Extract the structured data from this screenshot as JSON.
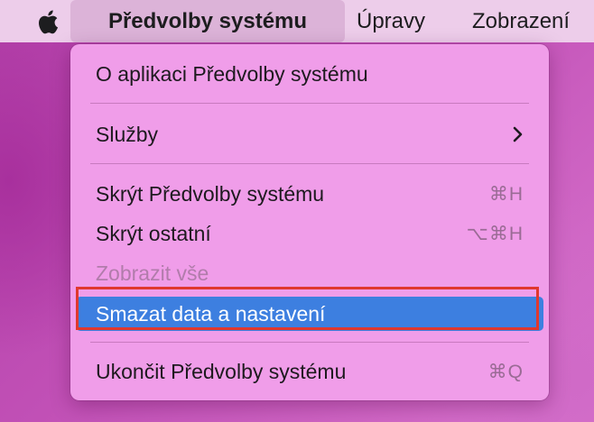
{
  "menubar": {
    "apple_icon": "apple-logo-icon",
    "items": [
      {
        "label": "Předvolby systému"
      },
      {
        "label": "Úpravy"
      },
      {
        "label": "Zobrazení"
      }
    ]
  },
  "menu": {
    "items": [
      {
        "label": "O aplikaci Předvolby systému",
        "shortcut": ""
      },
      {
        "label": "Služby",
        "submenu_icon": "chevron-right-icon"
      },
      {
        "label": "Skrýt Předvolby systému",
        "shortcut": "⌘H"
      },
      {
        "label": "Skrýt ostatní",
        "shortcut": "⌥⌘H"
      },
      {
        "label": "Zobrazit vše",
        "disabled": true
      },
      {
        "label": "Smazat data a nastavení",
        "highlighted": true
      },
      {
        "label": "Ukončit Předvolby systému",
        "shortcut": "⌘Q"
      }
    ]
  },
  "colors": {
    "menu_background": "#f09de9",
    "highlight": "#3d7fe0",
    "annotation_border": "#e0382e",
    "menubar": "#edcdea"
  }
}
